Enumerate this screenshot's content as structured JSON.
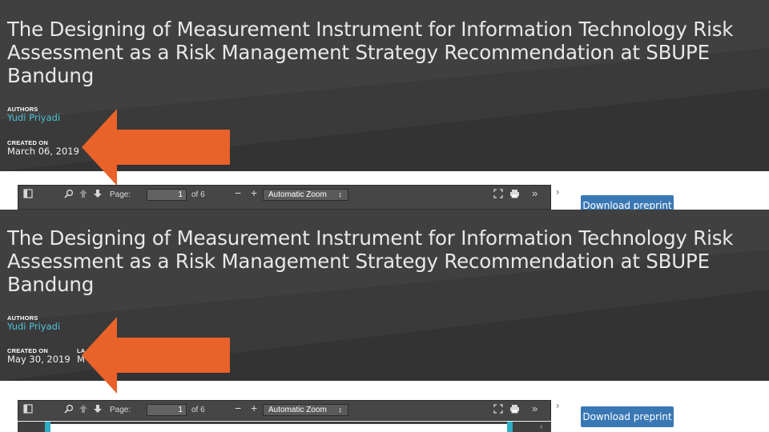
{
  "colors": {
    "hero_bg": "#3a3a3a",
    "author_link": "#4fc3d9",
    "arrow": "#e8622a",
    "download_button": "#3a78b5",
    "toolbar_bg": "#464646"
  },
  "panels": [
    {
      "title": "The Designing of Measurement Instrument for Information Technology Risk Assessment as a Risk Management Strategy Recommendation at SBUPE Bandung",
      "authors_label": "AUTHORS",
      "author": "Yudi Priyadi",
      "created_label": "CREATED ON",
      "created_value": "March 06, 2019",
      "toolbar": {
        "page_label": "Page:",
        "page_value": "1",
        "page_total": "of 6",
        "zoom": "Automatic Zoom",
        "zoom_caret": "↕",
        "minus": "−",
        "plus": "+"
      },
      "download_label": "Download preprint"
    },
    {
      "title": "The Designing of Measurement Instrument for Information Technology Risk Assessment as a Risk Management Strategy Recommendation at SBUPE Bandung",
      "authors_label": "AUTHORS",
      "author": "Yudi Priyadi",
      "created_label": "CREATED ON",
      "created_value": "May 30, 2019",
      "last_edited_label_partial": "LA",
      "last_edited_value_partial": "M",
      "toolbar": {
        "page_label": "Page:",
        "page_value": "1",
        "page_total": "of 6",
        "zoom": "Automatic Zoom",
        "zoom_caret": "↕",
        "minus": "−",
        "plus": "+"
      },
      "download_label": "Download preprint"
    }
  ],
  "icons": {
    "sidebar_toggle": "sidebar-toggle-icon",
    "search": "search-icon",
    "prev_page": "arrow-up-icon",
    "next_page": "arrow-down-icon",
    "fullscreen": "fullscreen-icon",
    "print": "print-icon",
    "more_tools": "double-chevron-right-icon",
    "collapse_panel": "chevron-right-icon",
    "annotation_arrow": "left-arrow-icon"
  }
}
